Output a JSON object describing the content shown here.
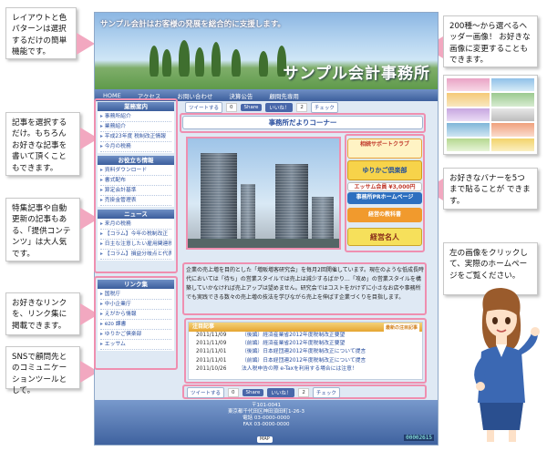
{
  "callouts": {
    "left1": "レイアウトと色パターンは選択するだけの簡単機能です。",
    "left2": "記事を選択するだけ。もちろんお好きな記事を書いて頂くこともできます。",
    "left3": "特集記事や自動更新の記事もある、「提供コンテンツ」は大人気です。",
    "left4": "お好きなリンクを、リンク集に掲載できます。",
    "left5": "SNSで顧問先とのコミュニケーションツールとして。",
    "right1": "200種～から選べるヘッダー画像！ お好きな画像に変更することもできます。",
    "right2": "お好きなバナーを5つまで貼ることが できます。",
    "right3": "左の画像をクリックして、実際のホームページをご覧ください。"
  },
  "site": {
    "tagline": "サンプル会計はお客様の発展を総合的に支援します。",
    "title": "サンプル会計事務所",
    "nav": [
      "HOME",
      "アクセス",
      "お問い合わせ",
      "決算公告",
      "顧問先専用"
    ],
    "sidebar": {
      "h1": "業務案内",
      "items1": [
        "事務所紹介",
        "業務紹介",
        "平成23年度 税制改正情報",
        "今月の税務"
      ],
      "h2": "お役立ち情報",
      "items2": [
        "資料ダウンロード",
        "書式配布",
        "算定会計基準",
        "売掛金管理表"
      ],
      "h3": "ニュース",
      "items3": [
        "来月の税務",
        "【コラム】今年の税制改正",
        "日主な注意したい雇用関連税制",
        "【コラム】損益分岐点と代表"
      ],
      "h4": "リンク集",
      "items4": [
        "国税庁",
        "中小企業庁",
        "えがから情報",
        "ezo 課書",
        "ゆりかご倶楽部",
        "エッサム"
      ]
    },
    "social": {
      "tweet": "ツイートする",
      "tweet_count": "0",
      "share": "Share",
      "like": "いいね！",
      "like_count": "2",
      "check": "チェック"
    },
    "section_title": "事務所だよりコーナー",
    "body": "企業の売上増を目的とした「増販増客研究会」を毎月2回開催しています。現在のような低成長時代においては「待ち」の営業スタイルでは売上は減少するばかり…「攻め」の営業スタイルを構築していかなければ売上アップは望めません。研究会ではコストをかけずに小さなお店や事務所でも実践できる数々の売上増の技法を学びながら売上を伸ばす企業づくりを目指します。",
    "notice": {
      "header": "注目記事",
      "rss": "最新の注目記事",
      "rows": [
        {
          "date": "2011/11/09",
          "text": "（後編）経済産業省2012年度税制改正要望"
        },
        {
          "date": "2011/11/09",
          "text": "（前編）経済産業省2012年度税制改正要望"
        },
        {
          "date": "2011/11/01",
          "text": "（後編）日本経団連2012年度税制改正について提言"
        },
        {
          "date": "2011/11/01",
          "text": "（前編）日本経団連2012年度税制改正について提言"
        },
        {
          "date": "2011/10/26",
          "text": "法人税申告の際 e-Taxを利用する場合には注意！"
        }
      ]
    },
    "banners": [
      "相続サポートクラブ",
      "ゆりかご倶楽部",
      "エッサム会員 ¥3,000円",
      "事務所PRホームページ",
      "経営の教科書",
      "経営名人"
    ],
    "footer": {
      "zip": "〒101-0041",
      "addr": "東京都千代田区神田須田町1-26-3",
      "tel": "電話 03-0000-0000",
      "fax": "FAX 03-0000-0000",
      "map": "MAP",
      "counter": "00002615"
    }
  },
  "colors": {
    "accent_pink": "#ef8fb0",
    "nav_blue": "#3d5f9c",
    "link_blue": "#2a4f9f"
  }
}
